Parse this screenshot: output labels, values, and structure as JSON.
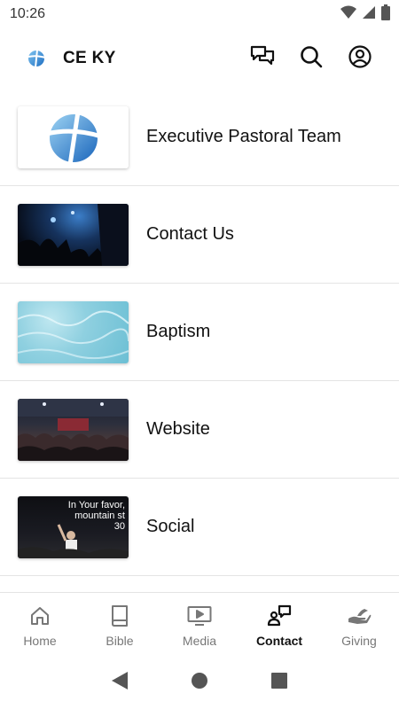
{
  "status": {
    "time": "10:26"
  },
  "header": {
    "title": "CE KY"
  },
  "list": {
    "items": [
      {
        "label": "Executive Pastoral Team"
      },
      {
        "label": "Contact Us"
      },
      {
        "label": "Baptism"
      },
      {
        "label": "Website"
      },
      {
        "label": "Social"
      }
    ]
  },
  "thumbnails": {
    "social_overlay_line1": "In Your favor,",
    "social_overlay_line2": "mountain st",
    "social_overlay_line3": "30"
  },
  "nav": {
    "items": [
      {
        "label": "Home",
        "icon": "home-icon"
      },
      {
        "label": "Bible",
        "icon": "book-icon"
      },
      {
        "label": "Media",
        "icon": "media-icon"
      },
      {
        "label": "Contact",
        "icon": "contact-icon"
      },
      {
        "label": "Giving",
        "icon": "giving-icon"
      }
    ],
    "active": "Contact"
  },
  "colors": {
    "accent": "#2b7fd0",
    "text": "#111111",
    "muted": "#777777",
    "divider": "#e4e4e4"
  }
}
